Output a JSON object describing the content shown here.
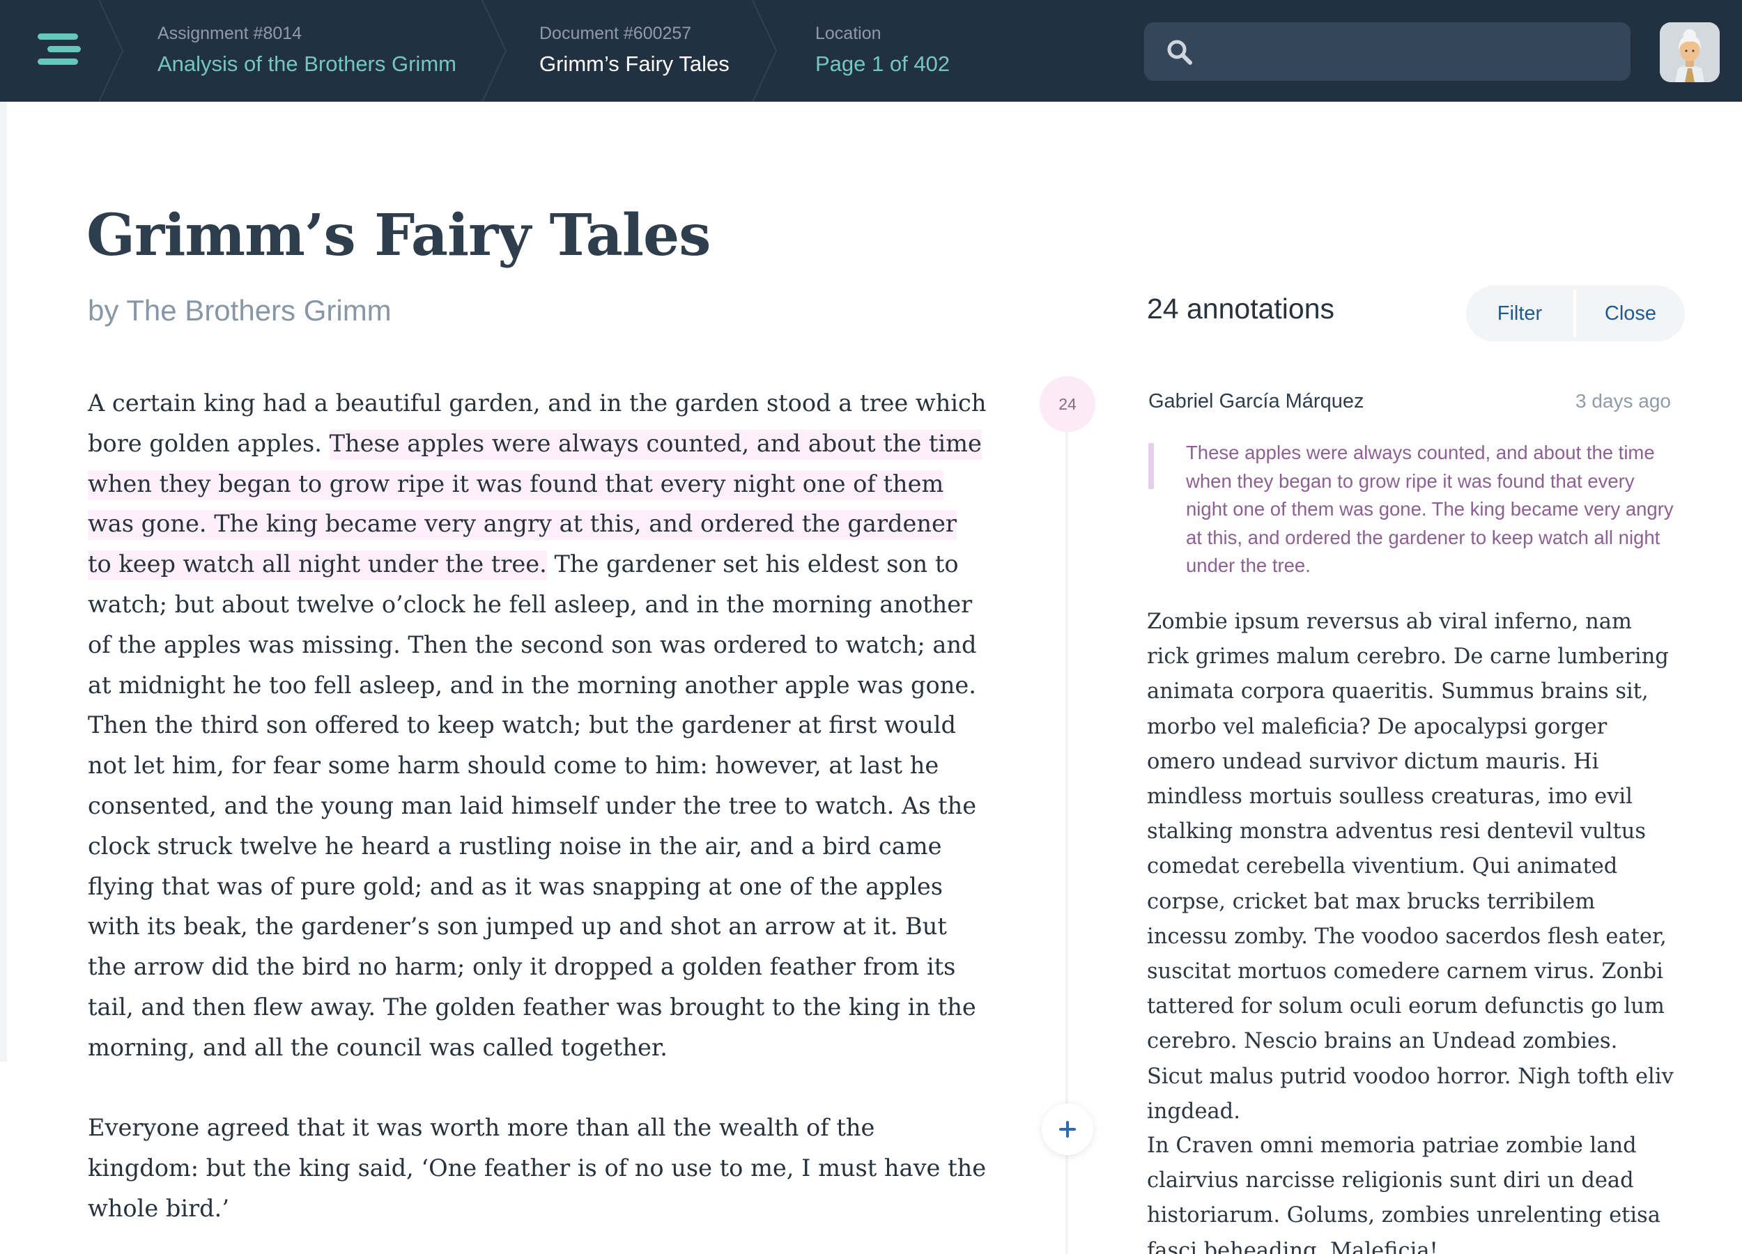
{
  "header": {
    "menu_icon": "hamburger-menu-icon",
    "breadcrumbs": [
      {
        "kicker": "Assignment #8014",
        "value": "Analysis of the Brothers Grimm"
      },
      {
        "kicker": "Document #600257",
        "value": "Grimm’s Fairy Tales"
      },
      {
        "kicker": "Location",
        "value": "Page 1 of 402"
      }
    ],
    "search": {
      "value": "",
      "placeholder": "",
      "icon": "search-icon"
    },
    "avatar_icon": "user-avatar-icon"
  },
  "document": {
    "title": "Grimm’s Fairy Tales",
    "byline": "by The Brothers Grimm",
    "paragraph1": {
      "before": "A certain king had a beautiful garden, and in the garden stood a tree which bore golden apples. ",
      "highlight": "These apples were always counted, and about the time when they began to grow ripe it was found that every night one of them was gone. The king became very angry at this, and ordered the gardener to keep watch all night under the tree.",
      "after": " The gardener set his eldest son to watch; but about twelve o’clock he fell asleep, and in the morning another of the apples was missing. Then the second son was ordered to watch; and at midnight he too fell asleep, and in the morning another apple was gone. Then the third son offered to keep watch; but the gardener at first would not let him, for fear some harm should come to him: however, at last he consented, and the young man laid himself under the tree to watch. As the clock struck twelve he heard a rustling noise in the air, and a bird came flying that was of pure gold; and as it was snapping at one of the apples with its beak, the gardener’s son jumped up and shot an arrow at it. But the arrow did the bird no harm; only it dropped a golden feather from its tail, and then flew away. The golden feather was brought to the king in the morning, and all the council was called together."
    },
    "paragraph2": "Everyone agreed that it was worth more than all the wealth of the kingdom: but the king said, ‘One feather is of no use to me, I must have the whole bird.’"
  },
  "gutter": {
    "annotation_count_badge": "24",
    "add_icon": "plus-icon"
  },
  "annotations": {
    "count_label": "24 annotations",
    "filter_label": "Filter",
    "close_label": "Close",
    "items": [
      {
        "author": "Gabriel García Márquez",
        "time": "3 days ago",
        "quote": "These apples were always counted, and about the time when they began to grow ripe it was found that every night one of them was gone. The king became very angry at this, and ordered the gardener to keep watch all night under the tree.",
        "body": [
          "Zombie ipsum reversus ab viral inferno, nam rick grimes malum cerebro. De carne lumbering animata corpora quaeritis. Summus brains sit, morbo vel maleficia? De apocalypsi gorger omero undead survivor dictum mauris. Hi mindless mortuis soulless creaturas, imo evil stalking monstra adventus resi dentevil vultus comedat cerebella viventium. Qui animated corpse, cricket bat max brucks terribilem incessu zomby. The voodoo sacerdos flesh eater, suscitat mortuos comedere carnem virus. Zonbi tattered for solum oculi eorum defunctis go lum cerebro. Nescio brains an Undead zombies. Sicut malus putrid voodoo horror. Nigh tofth eliv ingdead.",
          "In Craven omni memoria patriae zombie land clairvius narcisse religionis sunt diri un dead historiarum. Golums, zombies unrelenting etisa fasci beheading. Maleficia!"
        ]
      }
    ]
  },
  "colors": {
    "topbar": "#223141",
    "accent_teal": "#72c8bf",
    "highlight": "#fdf0fa",
    "quote_text": "#8e5f92",
    "button_text": "#1e5b92"
  }
}
